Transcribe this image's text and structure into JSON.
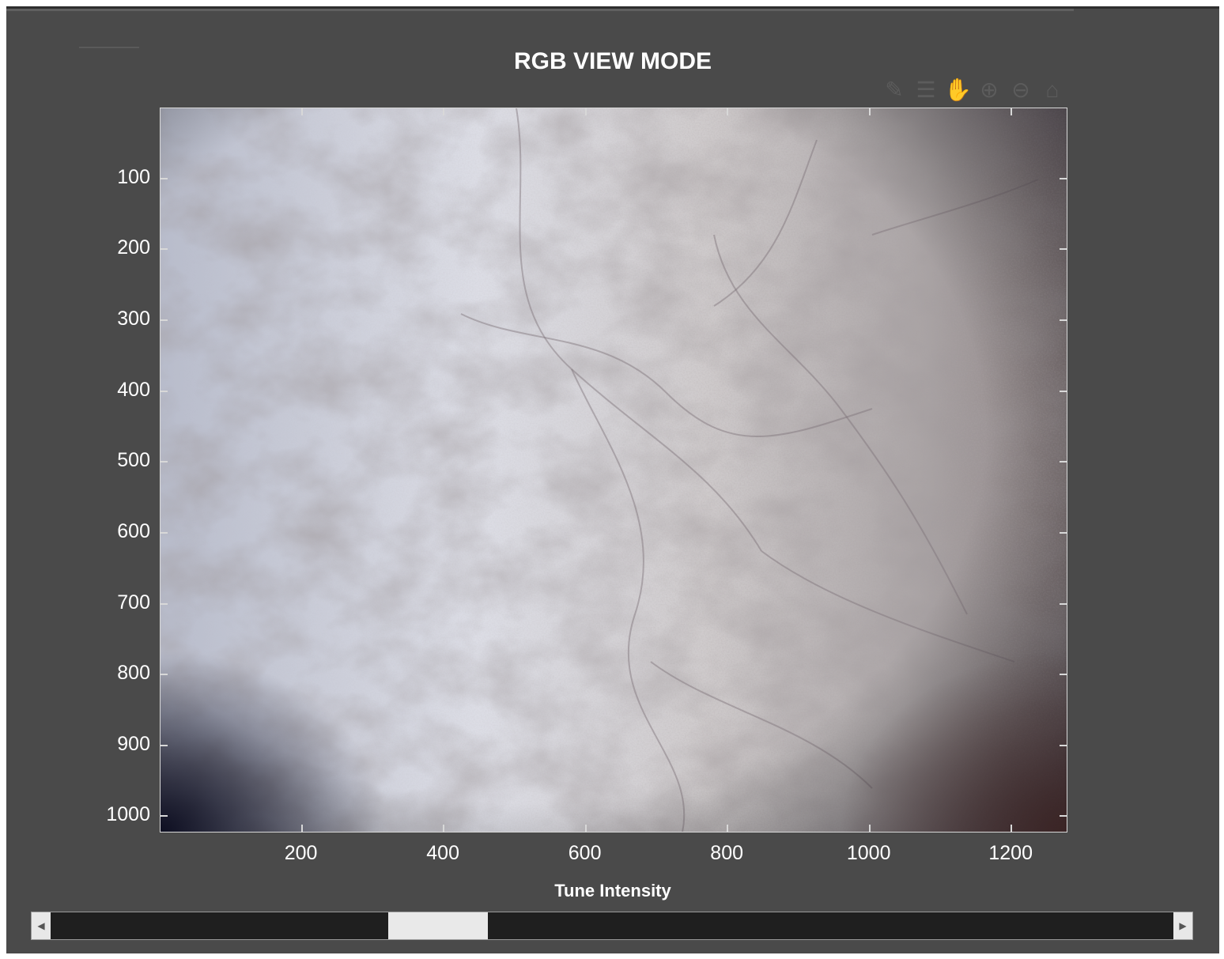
{
  "window": {
    "title": "RGB VIEW MODE"
  },
  "toolbar": {
    "icons": [
      "brush-icon",
      "datatip-icon",
      "pan-hand-icon",
      "zoom-in-icon",
      "zoom-out-icon",
      "home-icon"
    ]
  },
  "axes": {
    "y_ticks": [
      "100",
      "200",
      "300",
      "400",
      "500",
      "600",
      "700",
      "800",
      "900",
      "1000"
    ],
    "x_ticks": [
      "200",
      "400",
      "600",
      "800",
      "1000",
      "1200"
    ],
    "x_range": [
      1,
      1280
    ],
    "y_range": [
      1,
      1024
    ]
  },
  "slider": {
    "label": "Tune Intensity",
    "value_fraction": 0.33
  },
  "colors": {
    "background": "#4a4a4a",
    "track": "#1f1f1f",
    "thumb": "#e9e9e9",
    "text": "#ffffff"
  }
}
